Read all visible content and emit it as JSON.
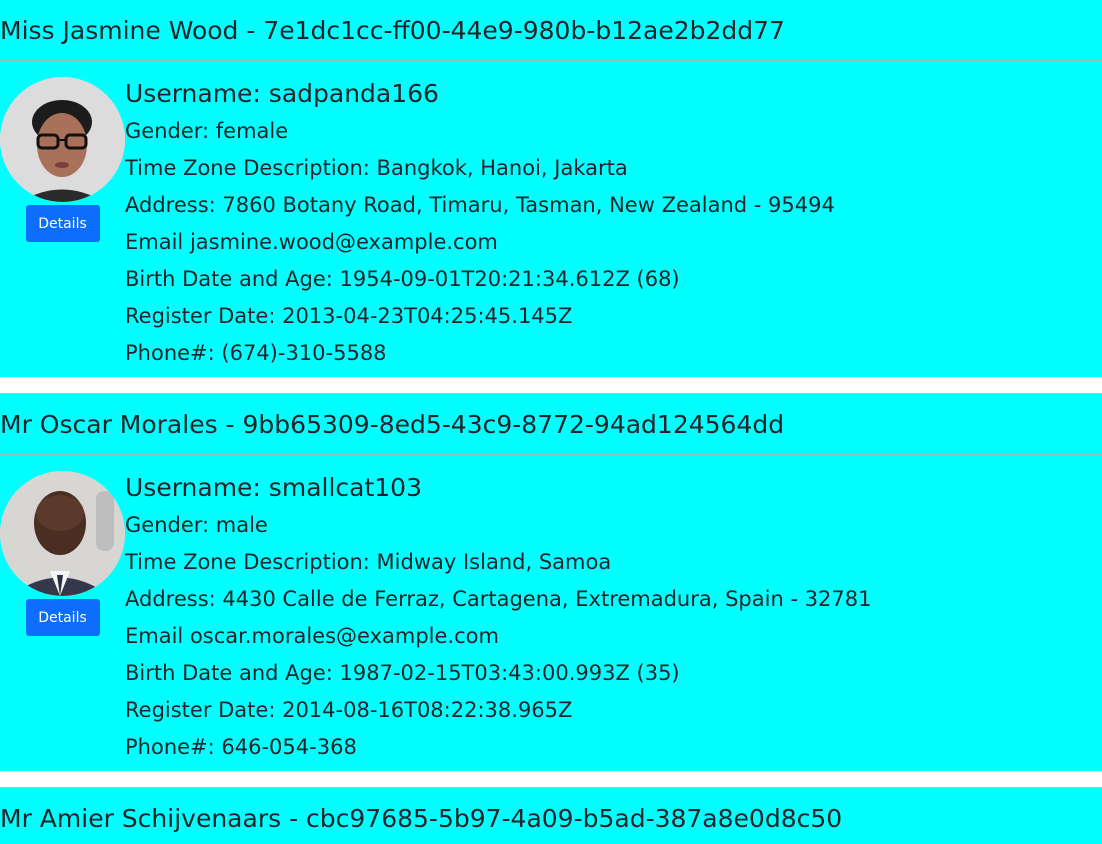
{
  "users": [
    {
      "header": "Miss Jasmine Wood - 7e1dc1cc-ff00-44e9-980b-b12ae2b2dd77",
      "username": "Username: sadpanda166",
      "gender": "Gender: female",
      "timezone": "Time Zone Description: Bangkok, Hanoi, Jakarta",
      "address": "Address: 7860 Botany Road, Timaru, Tasman, New Zealand - 95494",
      "email": "Email jasmine.wood@example.com",
      "birth": "Birth Date and Age: 1954-09-01T20:21:34.612Z (68)",
      "registered": "Register Date: 2013-04-23T04:25:45.145Z",
      "phone": "Phone#: (674)-310-5588",
      "details_label": "Details"
    },
    {
      "header": "Mr Oscar Morales - 9bb65309-8ed5-43c9-8772-94ad124564dd",
      "username": "Username: smallcat103",
      "gender": "Gender: male",
      "timezone": "Time Zone Description: Midway Island, Samoa",
      "address": "Address: 4430 Calle de Ferraz, Cartagena, Extremadura, Spain - 32781",
      "email": "Email oscar.morales@example.com",
      "birth": "Birth Date and Age: 1987-02-15T03:43:00.993Z (35)",
      "registered": "Register Date: 2014-08-16T08:22:38.965Z",
      "phone": "Phone#: 646-054-368",
      "details_label": "Details"
    },
    {
      "header": "Mr Amier Schijvenaars - cbc97685-5b97-4a09-b5ad-387a8e0d8c50"
    }
  ]
}
